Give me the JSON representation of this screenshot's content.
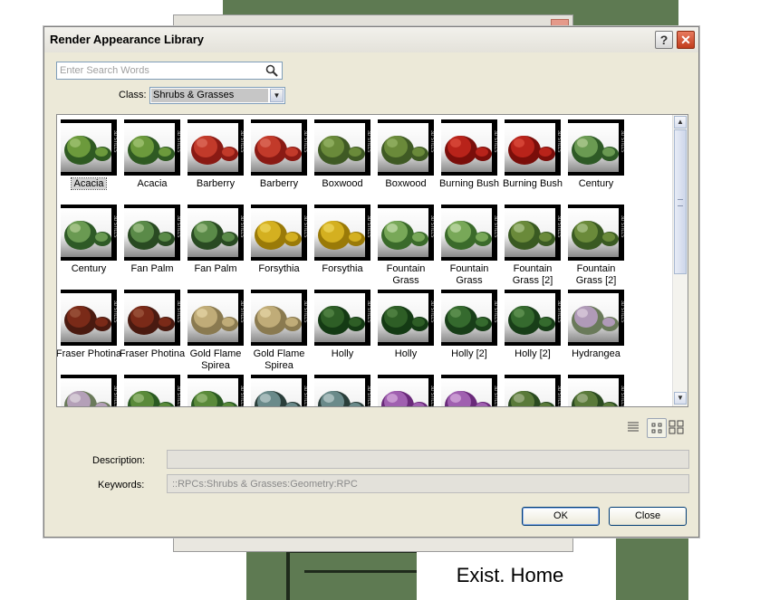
{
  "dialog": {
    "title": "Render Appearance Library",
    "help_glyph": "?",
    "close_glyph": "✕"
  },
  "search": {
    "placeholder": "Enter Search Words",
    "value": ""
  },
  "class_filter": {
    "label": "Class:",
    "value": "Shrubs & Grasses"
  },
  "grid": {
    "selected_index": 0,
    "items": [
      {
        "label": "Acacia",
        "style": "acacia"
      },
      {
        "label": "Acacia",
        "style": "acacia"
      },
      {
        "label": "Barberry",
        "style": "red"
      },
      {
        "label": "Barberry",
        "style": "red"
      },
      {
        "label": "Boxwood",
        "style": "box"
      },
      {
        "label": "Boxwood",
        "style": "box"
      },
      {
        "label": "Burning Bush",
        "style": "burning"
      },
      {
        "label": "Burning Bush",
        "style": "burning"
      },
      {
        "label": "Century",
        "style": "century"
      },
      {
        "label": "Century",
        "style": "century"
      },
      {
        "label": "Fan Palm",
        "style": "fanpalm"
      },
      {
        "label": "Fan Palm",
        "style": "fanpalm"
      },
      {
        "label": "Forsythia",
        "style": "yellow"
      },
      {
        "label": "Forsythia",
        "style": "yellow"
      },
      {
        "label": "Fountain Grass",
        "style": "grass"
      },
      {
        "label": "Fountain Grass",
        "style": "grass"
      },
      {
        "label": "Fountain Grass [2]",
        "style": "grass2"
      },
      {
        "label": "Fountain Grass [2]",
        "style": "grass2"
      },
      {
        "label": "Fraser Photina",
        "style": "fraser"
      },
      {
        "label": "Fraser Photina",
        "style": "fraser"
      },
      {
        "label": "Gold Flame Spirea",
        "style": "spirea"
      },
      {
        "label": "Gold Flame Spirea",
        "style": "spirea"
      },
      {
        "label": "Holly",
        "style": "holly"
      },
      {
        "label": "Holly",
        "style": "holly"
      },
      {
        "label": "Holly [2]",
        "style": "holly2"
      },
      {
        "label": "Holly [2]",
        "style": "holly2"
      },
      {
        "label": "Hydrangea",
        "style": "hydrangea"
      },
      {
        "label": "",
        "style": "row4a"
      },
      {
        "label": "",
        "style": "row4b"
      },
      {
        "label": "",
        "style": "row4b"
      },
      {
        "label": "",
        "style": "row4c"
      },
      {
        "label": "",
        "style": "row4c"
      },
      {
        "label": "",
        "style": "row4d"
      },
      {
        "label": "",
        "style": "row4d"
      },
      {
        "label": "",
        "style": "row4e"
      },
      {
        "label": "",
        "style": "row4e"
      }
    ],
    "watermark": "3D STILLS"
  },
  "views": [
    "list-view",
    "medium-icons-view",
    "large-icons-view"
  ],
  "description": {
    "label": "Description:",
    "value": ""
  },
  "keywords": {
    "label": "Keywords:",
    "value": "::RPCs:Shrubs & Grasses:Geometry:RPC"
  },
  "buttons": {
    "ok": "OK",
    "close": "Close"
  },
  "background": {
    "label": "Exist. Home"
  },
  "colors": {
    "cad_green": "#5e7a52",
    "dialog_bg": "#ece9d8",
    "accent_blue": "#7f9db9"
  }
}
